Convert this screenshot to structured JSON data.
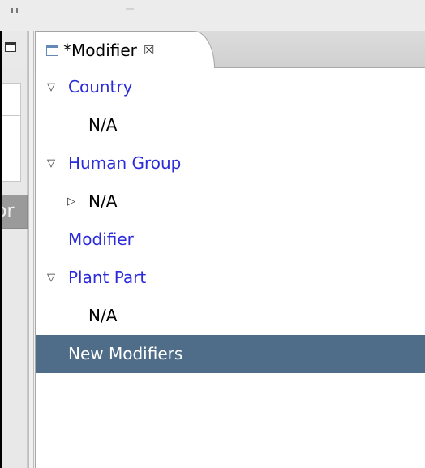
{
  "left_panel": {
    "button_text": "or"
  },
  "editor": {
    "tab": {
      "title": "*Modifier",
      "close_glyph": "☒"
    },
    "tree": [
      {
        "label": "Country",
        "expanded": true,
        "indent": 0,
        "color": "#2b2bdb"
      },
      {
        "label": "N/A",
        "expanded": null,
        "indent": 1,
        "color": "#000000"
      },
      {
        "label": "Human Group",
        "expanded": true,
        "indent": 0,
        "color": "#2b2bdb"
      },
      {
        "label": "N/A",
        "expanded": false,
        "indent": 1,
        "color": "#000000"
      },
      {
        "label": "Modifier",
        "expanded": null,
        "indent": 0,
        "color": "#2b2bdb"
      },
      {
        "label": "Plant Part",
        "expanded": true,
        "indent": 0,
        "color": "#2b2bdb"
      },
      {
        "label": "N/A",
        "expanded": null,
        "indent": 1,
        "color": "#000000"
      },
      {
        "label": "New Modifiers",
        "expanded": null,
        "indent": 0,
        "color": "#ffffff",
        "selected": true
      }
    ]
  },
  "colors": {
    "selection": "#4f6d89",
    "link_blue": "#2b2bdb"
  }
}
